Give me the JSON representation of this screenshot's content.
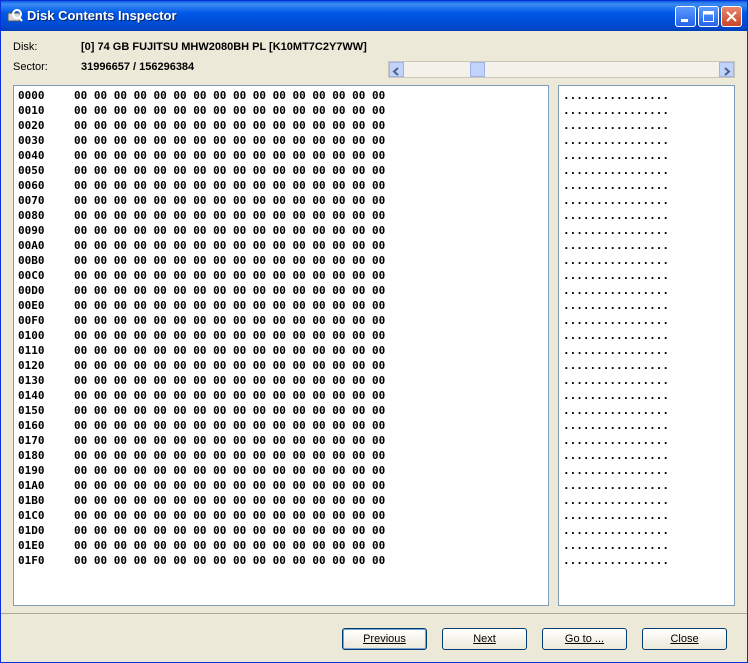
{
  "window": {
    "title": "Disk Contents Inspector"
  },
  "disk": {
    "label": "Disk:",
    "value": "[0] 74 GB  FUJITSU MHW2080BH PL [K10MT7C2Y7WW]"
  },
  "sector": {
    "label": "Sector:",
    "value": "31996657 / 156296384",
    "current": 31996657,
    "total": 156296384
  },
  "hex": {
    "offsets": [
      "0000",
      "0010",
      "0020",
      "0030",
      "0040",
      "0050",
      "0060",
      "0070",
      "0080",
      "0090",
      "00A0",
      "00B0",
      "00C0",
      "00D0",
      "00E0",
      "00F0",
      "0100",
      "0110",
      "0120",
      "0130",
      "0140",
      "0150",
      "0160",
      "0170",
      "0180",
      "0190",
      "01A0",
      "01B0",
      "01C0",
      "01D0",
      "01E0",
      "01F0"
    ],
    "row_bytes": "00 00 00 00 00 00 00 00 00 00 00 00 00 00 00 00",
    "ascii_row": "................"
  },
  "buttons": {
    "previous": "Previous",
    "next": "Next",
    "goto": "Go to ...",
    "close": "Close"
  }
}
